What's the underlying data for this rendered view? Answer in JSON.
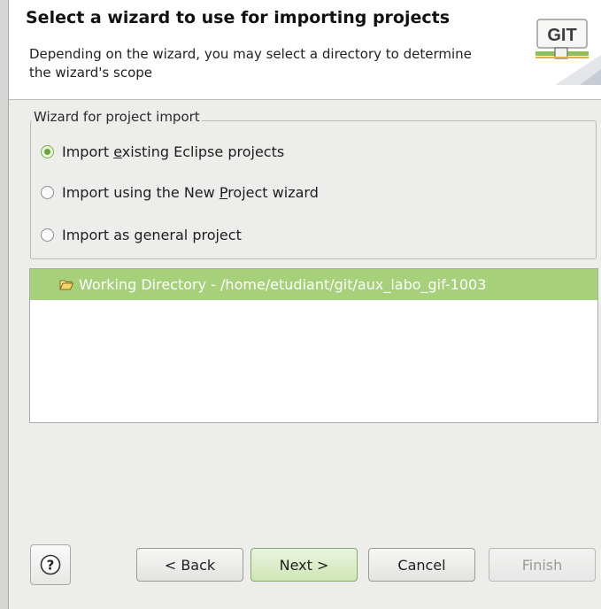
{
  "header": {
    "title": "Select a wizard to use for importing projects",
    "description": "Depending on the wizard, you may select a directory to determine the wizard's scope",
    "logo_text": "GIT"
  },
  "wizard_group": {
    "label": "Wizard for project import",
    "options": [
      {
        "label_pre": "Import ",
        "label_mnemonic": "e",
        "label_post": "xisting Eclipse projects",
        "checked": true
      },
      {
        "label_pre": "Import using the New ",
        "label_mnemonic": "P",
        "label_post": "roject wizard",
        "checked": false
      },
      {
        "label_pre": "Import as general project",
        "label_mnemonic": "",
        "label_post": "",
        "checked": false
      }
    ]
  },
  "directory_list": {
    "items": [
      {
        "label": "Working Directory - /home/etudiant/git/aux_labo_gif-1003",
        "icon": "folder-open-icon",
        "selected": true
      }
    ]
  },
  "buttons": {
    "help_icon": "?",
    "back": "< Back",
    "next": "Next >",
    "cancel": "Cancel",
    "finish": "Finish"
  },
  "colors": {
    "selection": "#a6d07a",
    "accent": "#6aa33a"
  }
}
